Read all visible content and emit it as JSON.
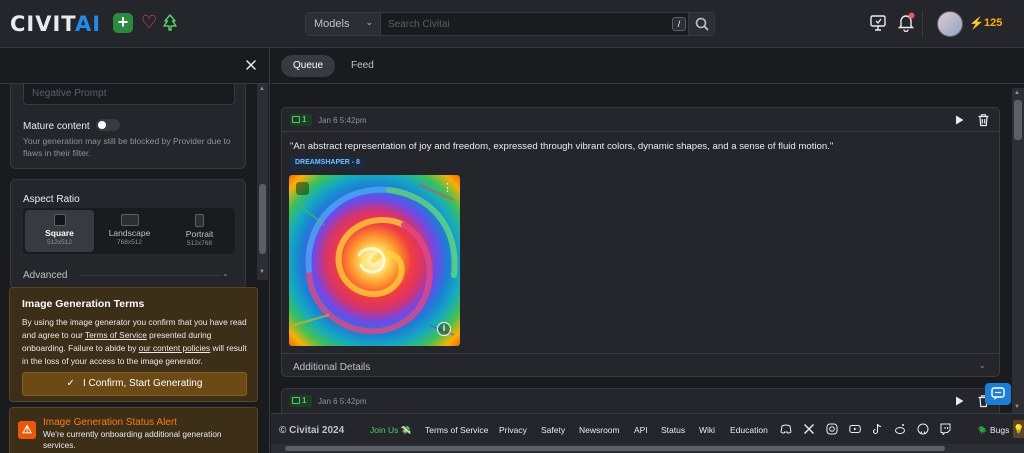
{
  "header": {
    "logo_main": "CIVIT",
    "logo_ai": "AI",
    "search_type": "Models",
    "search_placeholder": "Search Civitai",
    "search_shortcut": "/",
    "buzz_count": "125"
  },
  "sidebar": {
    "negative_prompt_placeholder": "Negative Prompt",
    "mature_label": "Mature content",
    "mature_note": "Your generation may still be blocked by Provider due to flaws in their filter.",
    "aspect_ratio_label": "Aspect Ratio",
    "aspect_options": [
      {
        "name": "Square",
        "dims": "512x512"
      },
      {
        "name": "Landscape",
        "dims": "768x512"
      },
      {
        "name": "Portrait",
        "dims": "512x768"
      }
    ],
    "advanced_label": "Advanced",
    "terms": {
      "title": "Image Generation Terms",
      "body_1": "By using the image generator you confirm that you have read and agree to our ",
      "tos_link": "Terms of Service",
      "body_2": " presented during onboarding. Failure to abide by ",
      "policy_link": "our content policies",
      "body_3": " will result in the loss of your access to the image generator.",
      "confirm_label": "I Confirm, Start Generating"
    },
    "alert": {
      "title": "Image Generation Status Alert",
      "body": "We're currently onboarding additional generation services."
    }
  },
  "main": {
    "tabs": [
      {
        "label": "Queue"
      },
      {
        "label": "Feed"
      }
    ],
    "generations": [
      {
        "count": "1",
        "date": "Jan 6 5:42pm",
        "prompt": "\"An abstract representation of joy and freedom, expressed through vibrant colors, dynamic shapes, and a sense of fluid motion.\"",
        "model": "DREAMSHAPER - 8",
        "details_label": "Additional Details"
      },
      {
        "count": "1",
        "date": "Jan 6 5:42pm"
      }
    ]
  },
  "footer": {
    "copyright": "© Civitai 2024",
    "join": "Join Us 💸",
    "links": [
      "Terms of Service",
      "Privacy",
      "Safety",
      "Newsroom",
      "API",
      "Status",
      "Wiki",
      "Education"
    ],
    "bugs": "🪲 Bugs"
  },
  "colors": {
    "accent": "#228be6",
    "terms_bg": "#3d2e17",
    "confirm_bg": "#6b4a16",
    "badge_green": "#51cf66"
  },
  "icons": [
    "plus-icon",
    "heart-icon",
    "tree-icon",
    "search-icon",
    "monitor-icon",
    "bell-icon",
    "bolt-icon",
    "close-icon",
    "play-icon",
    "trash-icon",
    "info-icon",
    "chevron-down-icon",
    "chat-icon",
    "discord-icon",
    "x-icon",
    "instagram-icon",
    "youtube-icon",
    "tiktok-icon",
    "reddit-icon",
    "github-icon",
    "twitch-icon"
  ]
}
